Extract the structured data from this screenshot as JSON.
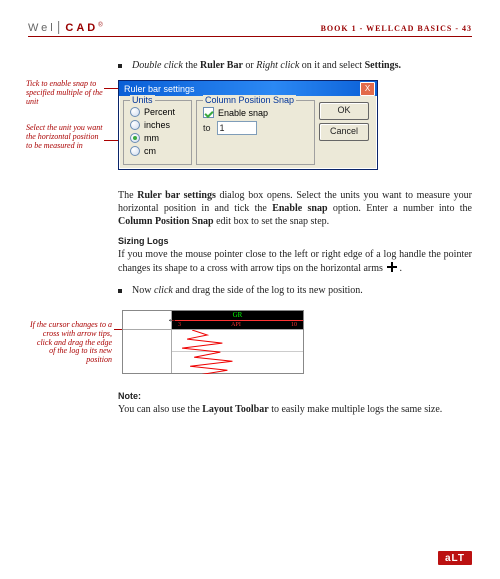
{
  "header": {
    "logo_well": "Wel",
    "logo_cad": "CAD",
    "book_line": "BOOK 1 - WELLCAD BASICS - 43"
  },
  "intro_bullet": {
    "prefix": "Double click",
    "part2": " the ",
    "bold2": "Ruler Bar",
    "part3": " or ",
    "italic3": "Right click",
    "part4": " on it and select ",
    "bold4": "Settings."
  },
  "annotations": {
    "top": "Tick to enable snap to specified multiple of the unit",
    "bottom": "Select the unit you want the horizontal position to be measured in"
  },
  "dialog": {
    "title": "Ruler bar settings",
    "close": "X",
    "units_legend": "Units",
    "units": [
      "Percent",
      "inches",
      "mm",
      "cm"
    ],
    "units_selected_index": 2,
    "snap_legend": "Column Position Snap",
    "enable_snap": "Enable snap",
    "to_label": "to",
    "to_value": "1",
    "ok": "OK",
    "cancel": "Cancel"
  },
  "para1": {
    "a": "The ",
    "b": "Ruler bar settings",
    "c": " dialog box opens. Select the units you want to measure your horizontal position in and tick the ",
    "d": "Enable snap",
    "e": " option. Enter a number into the ",
    "f": "Column Position Snap",
    "g": " edit box to set the snap step."
  },
  "sizing": {
    "heading": "Sizing Logs",
    "p_a": "If you move the mouse pointer close to the left or right edge of a log handle the pointer changes its shape to a cross with arrow tips on the horizontal arms ",
    "p_b": ".",
    "bullet_a": "Now ",
    "bullet_i": "click",
    "bullet_b": " and drag the side of the log to its new position."
  },
  "log_fig": {
    "annot": "If the cursor changes to a cross with arrow tips, click and drag the edge of the log to its new position",
    "track_title": "GR",
    "scale_left": "3",
    "scale_unit": "API",
    "scale_right": "10"
  },
  "note": {
    "heading": "Note:",
    "a": "You can also use the ",
    "b": "Layout Toolbar",
    "c": " to easily make multiple logs the same size."
  },
  "footer": {
    "logo": "aLT"
  }
}
